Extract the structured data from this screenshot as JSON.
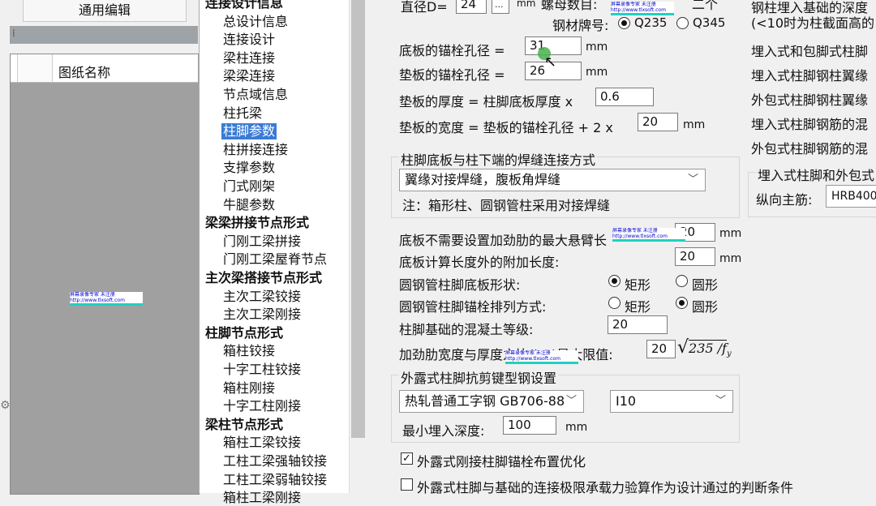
{
  "left_pane": {
    "tab_label": "通用编辑",
    "grip": "⁞",
    "column_header": "图纸名称"
  },
  "tree": {
    "items": [
      {
        "text": "连接设计信息",
        "group": true
      },
      {
        "text": "总设计信息"
      },
      {
        "text": "连接设计"
      },
      {
        "text": "梁柱连接"
      },
      {
        "text": "梁梁连接"
      },
      {
        "text": "节点域信息"
      },
      {
        "text": "柱托梁"
      },
      {
        "text": "柱脚参数",
        "selected": true
      },
      {
        "text": "柱拼接连接"
      },
      {
        "text": "支撑参数"
      },
      {
        "text": "门式刚架"
      },
      {
        "text": "牛腿参数"
      },
      {
        "text": "梁梁拼接节点形式",
        "group": true
      },
      {
        "text": "门刚工梁拼接"
      },
      {
        "text": "门刚工梁屋脊节点"
      },
      {
        "text": "主次梁搭接节点形式",
        "group": true
      },
      {
        "text": "主次工梁铰接"
      },
      {
        "text": "主次工梁刚接"
      },
      {
        "text": "柱脚节点形式",
        "group": true
      },
      {
        "text": "箱柱铰接"
      },
      {
        "text": "十字工柱铰接"
      },
      {
        "text": "箱柱刚接"
      },
      {
        "text": "十字工柱刚接"
      },
      {
        "text": "梁柱节点形式",
        "group": true
      },
      {
        "text": "箱柱工梁铰接"
      },
      {
        "text": "工柱工梁强轴铰接"
      },
      {
        "text": "工柱工梁弱轴铰接"
      },
      {
        "text": "箱柱工梁刚接"
      }
    ]
  },
  "panel": {
    "diameter_label": "直径D=",
    "diameter_value": "24",
    "dots_button": "...",
    "mm": "mm",
    "nut_label": "螺母数目:",
    "nut_right": "二个",
    "steel_grade_label": "钢材牌号:",
    "q235": "Q235",
    "q345": "Q345",
    "base_hole_label": "底板的锚栓孔径 =",
    "base_hole_value": "31",
    "pad_hole_label": "垫板的锚栓孔径 =",
    "pad_hole_value": "26",
    "pad_thick_label": "垫板的厚度 = 柱脚底板厚度 x",
    "pad_thick_value": "0.6",
    "pad_width_label": "垫板的宽度 = 垫板的锚栓孔径 + 2 x",
    "pad_width_value": "20",
    "weld_group_title": "柱脚底板与柱下端的焊缝连接方式",
    "weld_select": "翼缘对接焊缝，腹板角焊缝",
    "weld_note": "注：箱形柱、圆钢管柱采用对接焊缝",
    "max_cantilever_label": "底板不需要设置加劲肋的最大悬臂长",
    "max_cantilever_value": "20",
    "extra_length_label": "底板计算长度外的附加长度:",
    "extra_length_value": "20",
    "pipe_shape_label": "圆钢管柱脚底板形状:",
    "rect": "矩形",
    "circle": "圆形",
    "pipe_bolt_label": "圆钢管柱脚锚栓排列方式:",
    "concrete_label": "柱脚基础的混凝土等级:",
    "concrete_value": "20",
    "rib_ratio_label": "加劲肋宽度与厚度之比(b/t)最大限值:",
    "rib_ratio_value": "20",
    "formula_235": "235 /",
    "formula_fy": "f",
    "formula_y": "y",
    "shear_group_title": "外露式柱脚抗剪键型钢设置",
    "shear_select_1": "热轧普通工字钢 GB706-88",
    "shear_select_2": "I10",
    "min_depth_label": "最小埋入深度:",
    "min_depth_value": "100",
    "opt_checkbox": "外露式刚接柱脚锚栓布置优化",
    "ultimate_checkbox": "外露式柱脚与基础的连接极限承载力验算作为设计通过的判断条件"
  },
  "right_col": {
    "line1": "钢柱埋入基础的深度",
    "line2": "(<10时为柱截面高的",
    "line3": "埋入式和包脚式柱脚",
    "line4": "埋入式柱脚钢柱翼缘",
    "line5": "外包式柱脚钢柱翼缘",
    "line6": "埋入式柱脚钢筋的混",
    "line7": "外包式柱脚钢筋的混",
    "group_title": "埋入式柱脚和外包式",
    "rebar_label": "纵向主筋:",
    "rebar_value": "HRB400"
  },
  "watermark": {
    "line1": "屏幕录像专家      未注册",
    "line2": "http://www.tlxsoft.com"
  }
}
